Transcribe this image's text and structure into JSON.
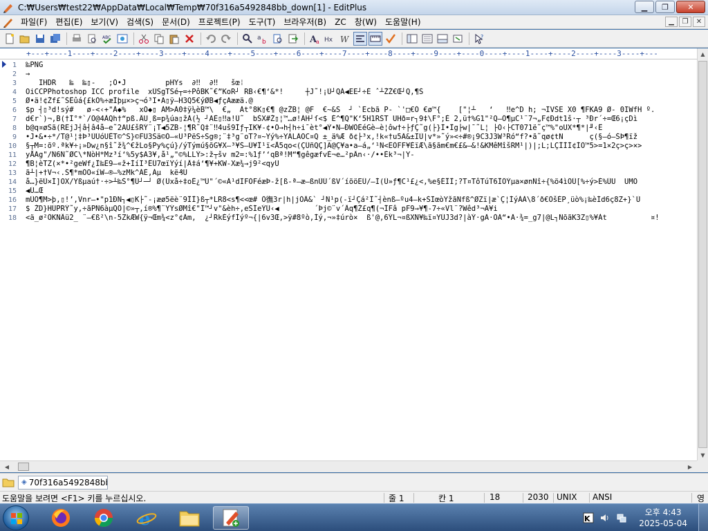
{
  "window": {
    "title": "C:₩Users₩test22₩AppData₩Local₩Temp₩70f316a5492848bb_down[1] - EditPlus"
  },
  "menu": [
    "파일(F)",
    "편집(E)",
    "보기(V)",
    "검색(S)",
    "문서(D)",
    "프로젝트(P)",
    "도구(T)",
    "브라우저(B)",
    "ZC",
    "창(W)",
    "도움말(H)"
  ],
  "ruler": "+---+----1----+----2----+----3----+----4----+----5----+----6----+----7----+----8----+----9----+----0----+----1----+----2----+----3----+---",
  "editor": {
    "lines": [
      {
        "n": "1",
        "text": "‰PNG"
      },
      {
        "n": "2",
        "text": "→"
      },
      {
        "n": "3",
        "text": "   IHDR   ‱  ‱▯-   ;Ö•J         pHYs  ∂‼  ∂‼   šœ⁞"
      },
      {
        "n": "4",
        "text": "OiCCPPhotoshop ICC profile  xÚSgTSé┬=÷PôBK˜€”KoR┘ RB‹€¶‘&*!     ┼J˜!¡Ù┘QÁ◀EE┘÷È ˆ┴ŽŽ€Œ┘Q,¶Š"
      },
      {
        "n": "5",
        "text": "Ø•ä!¢Žf£˜ŠÊûá{£kÖ%÷æÍþµ×>ç¬ó³Ï•Ã▯ÿ–H3Q5€ýØB◀ƒçÃææä.@"
      },
      {
        "n": "6",
        "text": "$p ┤▯³d!sý#   ø-<‹+\"À◆%   xÓ◆▯ ÀM>À0‡ÿ¼èB™\\  €„  Àt°8K▯€¶ @zŽB¦ @F  €~&S  ┘ `Ëcbã P- `'□€Ó €ø™{    [\"¦┴   ‘   ‼e^D h; ¬ÏVŠE X0 ¶FKÄ9 Ø- 0IWfH º.  "
      },
      {
        "n": "7",
        "text": "d€r`)¬,B(†Í°*`/Ô@4ÀQh†“pß.ÂU¸ß=p¾úa▯žÁ(½ ┘AÈ▯‼a!Ú˜  bŠX#Ž▯¦™…ø!ÁH┘ſ<$ É^¶Q\"K‘5H1RŠT UHð=r┐9‡\\F°;È 2,ü†%G1\"²Q—Ô¶µC¹¨7¬„F¢Ðdt1š·┬ ³Ðr´÷=Œ6¡çDì"
      },
      {
        "n": "8",
        "text": "b@q¤øSã(RËjJ┤â┤â4å–e˜2AU£šRÝ¨¡T◀5ZB-¦¶R˜Q‡¨‼4uš9Íƒ┬IK¥-¢•Ó→h┤h÷i¯èt°◀Ý•N—ÐWÔÈéGè–è¦ôw†÷├ƒÇ˜g(├}Ì•Îg├w|¯˜L¦ ├Ó‹├CT071ë˜ç™%\"oUX*¶*|╜‹Ê"
      },
      {
        "n": "9",
        "text": "•J•&•÷*/T@¹¦‡Þ³ÙÚóUÊT©^S}©FU3Sä©Ó–«U³PëS÷Sg®;¨‡³g¨oT?¤~Yý%÷YÄLÄOC¤Q ±_ä%Æ ð¢├³x,!k«†u5Ä&±ÏÙ|v*»˜ý»<÷#®¡9C3J3W³Ró“f?•ã˜qø¢tN      ç(§–ó–ŠÞ¶ïž"
      },
      {
        "n": "10",
        "text": "§┬M=:õº.ªk¥÷¡»Dw¿n§î˜ž¾^€žLo§Py%çú}/ýTýmú§õG¥X–³¥Š–Ù¥Î¹ï<Å5qo<(ÇÛñQÇ]Ã@Ç¥a•a–á„‘¹Ñ<ËÔFF¥ÈïÆ\\ã§ãm€m€£&–&!&KMêMîšRM¹|)|;L;LÇÎÌÍ¢ÍÖ™5>=1×2ç>ç>×>"
      },
      {
        "n": "11",
        "text": "yÅÃg\"/Ñ6Ñ˜ØC\\*NòH*Mz³í‘%5y$Ã3¥,å¹„\"©%LLÝ>:ž┬šv m2=:%1ƒ’‘qBª!M“¶gêgæfvÈ¬e…²pÂn‹·/••Ék³¬|Y-"
      },
      {
        "n": "12",
        "text": "¶B¦èTZ(×*•²geWf¿Î‰Ë9–«ž+ÍíÏ³ÊÛ7œïŸýí|Â‡á‘¶¥+KW-Xæ¾→j9²<qyÙ"
      },
      {
        "n": "13",
        "text": "ã┴|+†V¬‹.Š¶*mÕO«íW–®–%zMk^ÁÈ,Áµ  kë₰U"
      },
      {
        "n": "14",
        "text": "å…}ëÙ×Í]OX/Yßµaú†·÷>┴‰Š°¶Û┘─┘ Ø(Üxå÷‡oÊ¿™Ü\"´©«Ä¹dÏFÒFéæÞ-ž[ß-ª—æ–ßnÙÚ´ßV´íõöEÛ/—Í(Û»ƒ¶C¹£¿<‚%e§ÉÎÎ;?T¤TôTúT6ÎÔÝµa×ønÑî÷{%ö4ìÕÛ[%÷ý>É%ÛU  UMÕ"
      },
      {
        "n": "15",
        "text": "◀Ü…Œ"
      },
      {
        "n": "16",
        "text": "mÚÕ¶M>þ,▯!’,Vnr–•\"p1ÐN┐◀▯K├˜-¡æø5ëè¨9ÎÎ}ß┬*LR8<s¶<<œ# Ö㣳3r|h|jÓÂ&` ┘Ñ¹p(-ï┘Çá²Î˜┤ènß–ºu4–k+ŠÏœòYžãNfß^ØZï|æ`Ç¦ÍýÀÀ\\8´ð€ÖšÉP¸üò%¡‰èÍd6ç8Z+}`Ù"
      },
      {
        "n": "17",
        "text": "$ ŽD}HÜPRÝ˜y,÷ãPÑ6àµQÕ|©»┬,í®%¶¨YÝsØMî€\"Î™┘v\"&èh÷,eŠÍeÝÚ‹◀        ´Þj©¨v´Âq¶Ž£q¶(¬ÎFâ pF9→¥¶-7÷«Vl¨?Wêd³¬Ã¥i"
      },
      {
        "n": "18",
        "text": "<ä_ø²ÖKNÂü2_ ¨–€ß²\\n-5ZkÆW{ÿ¬Œm¾<z°¢Àm‚  ¿┘RkÉýfÍýº¬{|6v3Œ,>ÿ#8ºò,Íý,¬»‡úrò×  ß'@,6ÝL¬¤ßXN¥‰ï¤YÚJ3d?|àÝ·gÄ·ÒÄ“•Ä·¾=_g7|@L┐ÑõãK3Z▯%¥Àt          ¤!"
      }
    ]
  },
  "file_tab": {
    "name": "70f316a5492848bb"
  },
  "status": {
    "help": "도움말을 보려면 <F1> 키를 누르십시오.",
    "line": "줄 1",
    "col": "칸 1",
    "lines_count": "18",
    "size": "2030",
    "eol": "UNIX",
    "encoding": "ANSI",
    "ime": "영"
  },
  "taskbar": {
    "time": "오후 4:43",
    "date": "2025-05-04",
    "apps": [
      "firefox-icon",
      "chrome-icon",
      "ie-icon",
      "explorer-icon",
      "editplus-icon"
    ]
  }
}
